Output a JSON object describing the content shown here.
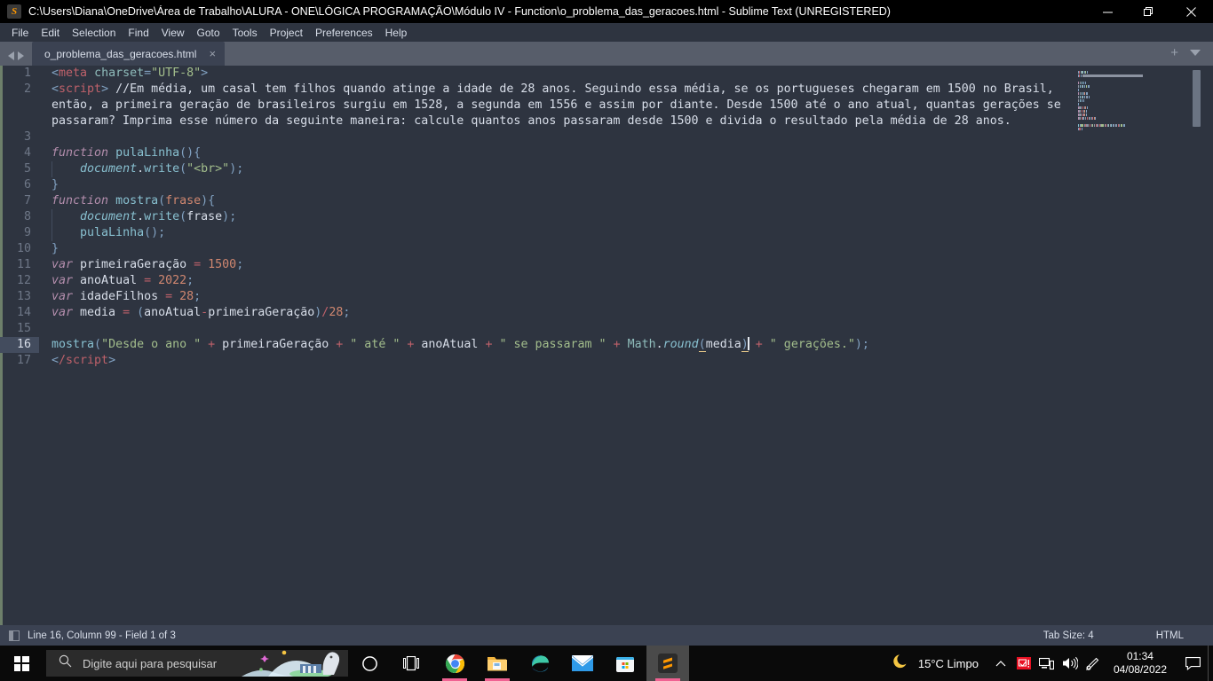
{
  "window": {
    "title": "C:\\Users\\Diana\\OneDrive\\Área de Trabalho\\ALURA - ONE\\LÓGICA PROGRAMAÇÃO\\Módulo IV - Function\\o_problema_das_geracoes.html - Sublime Text (UNREGISTERED)",
    "app_icon": "S",
    "minimize_label": "Minimize",
    "maximize_label": "Restore",
    "close_label": "Close"
  },
  "menubar": {
    "items": [
      "File",
      "Edit",
      "Selection",
      "Find",
      "View",
      "Goto",
      "Tools",
      "Project",
      "Preferences",
      "Help"
    ]
  },
  "tabbar": {
    "tabs": [
      {
        "label": "o_problema_das_geracoes.html",
        "close": "×",
        "active": true
      }
    ],
    "new_tab": "+",
    "dropdown": "chevron-down-icon"
  },
  "editor": {
    "background": "#2e3440",
    "active_line": 16,
    "lines": [
      {
        "n": 1,
        "tokens": [
          {
            "t": "<",
            "c": "punc"
          },
          {
            "t": "meta",
            "c": "tag"
          },
          {
            "t": " ",
            "c": "plain"
          },
          {
            "t": "charset",
            "c": "attr"
          },
          {
            "t": "=",
            "c": "punc"
          },
          {
            "t": "\"UTF-8\"",
            "c": "str"
          },
          {
            "t": ">",
            "c": "punc"
          }
        ]
      },
      {
        "n": 2,
        "tokens": [
          {
            "t": "<",
            "c": "punc"
          },
          {
            "t": "script",
            "c": "tag"
          },
          {
            "t": ">",
            "c": "punc"
          },
          {
            "t": " //Em média, um casal tem filhos quando atinge a idade de 28 anos. Seguindo essa média, se os portugueses chegaram em 1500 no Brasil, então, a primeira geração de brasileiros surgiu em 1528, a segunda em 1556 e assim por diante. Desde 1500 até o ano atual, quantas gerações se passaram? Imprima esse número da seguinte maneira: calcule quantos anos passaram desde 1500 e divida o resultado pela média de 28 anos.",
            "c": "comment"
          }
        ]
      },
      {
        "n": 3,
        "tokens": []
      },
      {
        "n": 4,
        "tokens": [
          {
            "t": "function",
            "c": "kw"
          },
          {
            "t": " ",
            "c": "plain"
          },
          {
            "t": "pulaLinha",
            "c": "fn"
          },
          {
            "t": "()",
            "c": "punc"
          },
          {
            "t": "{",
            "c": "punc"
          }
        ]
      },
      {
        "n": 5,
        "indent": 1,
        "tokens": [
          {
            "t": "    ",
            "c": "plain"
          },
          {
            "t": "document",
            "c": "fn-i"
          },
          {
            "t": ".",
            "c": "plain"
          },
          {
            "t": "write",
            "c": "fn"
          },
          {
            "t": "(",
            "c": "punc"
          },
          {
            "t": "\"<br>\"",
            "c": "str"
          },
          {
            "t": ")",
            "c": "punc"
          },
          {
            "t": ";",
            "c": "punc"
          }
        ]
      },
      {
        "n": 6,
        "tokens": [
          {
            "t": "}",
            "c": "punc"
          }
        ]
      },
      {
        "n": 7,
        "tokens": [
          {
            "t": "function",
            "c": "kw"
          },
          {
            "t": " ",
            "c": "plain"
          },
          {
            "t": "mostra",
            "c": "fn"
          },
          {
            "t": "(",
            "c": "punc"
          },
          {
            "t": "frase",
            "c": "param"
          },
          {
            "t": ")",
            "c": "punc"
          },
          {
            "t": "{",
            "c": "punc"
          }
        ]
      },
      {
        "n": 8,
        "indent": 1,
        "tokens": [
          {
            "t": "    ",
            "c": "plain"
          },
          {
            "t": "document",
            "c": "fn-i"
          },
          {
            "t": ".",
            "c": "plain"
          },
          {
            "t": "write",
            "c": "fn"
          },
          {
            "t": "(",
            "c": "punc"
          },
          {
            "t": "frase",
            "c": "plain"
          },
          {
            "t": ")",
            "c": "punc"
          },
          {
            "t": ";",
            "c": "punc"
          }
        ]
      },
      {
        "n": 9,
        "indent": 1,
        "tokens": [
          {
            "t": "    ",
            "c": "plain"
          },
          {
            "t": "pulaLinha",
            "c": "fn"
          },
          {
            "t": "()",
            "c": "punc"
          },
          {
            "t": ";",
            "c": "punc"
          }
        ]
      },
      {
        "n": 10,
        "tokens": [
          {
            "t": "}",
            "c": "punc"
          }
        ]
      },
      {
        "n": 11,
        "tokens": [
          {
            "t": "var",
            "c": "kw"
          },
          {
            "t": " primeiraGeração ",
            "c": "plain"
          },
          {
            "t": "=",
            "c": "op"
          },
          {
            "t": " ",
            "c": "plain"
          },
          {
            "t": "1500",
            "c": "num"
          },
          {
            "t": ";",
            "c": "punc"
          }
        ]
      },
      {
        "n": 12,
        "tokens": [
          {
            "t": "var",
            "c": "kw"
          },
          {
            "t": " anoAtual ",
            "c": "plain"
          },
          {
            "t": "=",
            "c": "op"
          },
          {
            "t": " ",
            "c": "plain"
          },
          {
            "t": "2022",
            "c": "num"
          },
          {
            "t": ";",
            "c": "punc"
          }
        ]
      },
      {
        "n": 13,
        "tokens": [
          {
            "t": "var",
            "c": "kw"
          },
          {
            "t": " idadeFilhos ",
            "c": "plain"
          },
          {
            "t": "=",
            "c": "op"
          },
          {
            "t": " ",
            "c": "plain"
          },
          {
            "t": "28",
            "c": "num"
          },
          {
            "t": ";",
            "c": "punc"
          }
        ]
      },
      {
        "n": 14,
        "tokens": [
          {
            "t": "var",
            "c": "kw"
          },
          {
            "t": " media ",
            "c": "plain"
          },
          {
            "t": "=",
            "c": "op"
          },
          {
            "t": " ",
            "c": "plain"
          },
          {
            "t": "(",
            "c": "punc"
          },
          {
            "t": "anoAtual",
            "c": "plain"
          },
          {
            "t": "-",
            "c": "op"
          },
          {
            "t": "primeiraGeração",
            "c": "plain"
          },
          {
            "t": ")",
            "c": "punc"
          },
          {
            "t": "/",
            "c": "op"
          },
          {
            "t": "28",
            "c": "num"
          },
          {
            "t": ";",
            "c": "punc"
          }
        ]
      },
      {
        "n": 15,
        "tokens": []
      },
      {
        "n": 16,
        "active": true,
        "tokens": [
          {
            "t": "mostra",
            "c": "fn"
          },
          {
            "t": "(",
            "c": "punc"
          },
          {
            "t": "\"Desde o ano \"",
            "c": "str"
          },
          {
            "t": " ",
            "c": "plain"
          },
          {
            "t": "+",
            "c": "op"
          },
          {
            "t": " primeiraGeração ",
            "c": "plain"
          },
          {
            "t": "+",
            "c": "op"
          },
          {
            "t": " ",
            "c": "plain"
          },
          {
            "t": "\" até \"",
            "c": "str"
          },
          {
            "t": " ",
            "c": "plain"
          },
          {
            "t": "+",
            "c": "op"
          },
          {
            "t": " anoAtual ",
            "c": "plain"
          },
          {
            "t": "+",
            "c": "op"
          },
          {
            "t": " ",
            "c": "plain"
          },
          {
            "t": "\" se passaram \"",
            "c": "str"
          },
          {
            "t": " ",
            "c": "plain"
          },
          {
            "t": "+",
            "c": "op"
          },
          {
            "t": " ",
            "c": "plain"
          },
          {
            "t": "Math",
            "c": "obj"
          },
          {
            "t": ".",
            "c": "plain"
          },
          {
            "t": "round",
            "c": "fn-i"
          },
          {
            "t": "(",
            "c": "punc",
            "hl": true
          },
          {
            "t": "media",
            "c": "plain"
          },
          {
            "t": ")",
            "c": "punc",
            "hl": true
          },
          {
            "t": "CURSOR",
            "c": "cursor"
          },
          {
            "t": " ",
            "c": "plain"
          },
          {
            "t": "+",
            "c": "op"
          },
          {
            "t": " ",
            "c": "plain"
          },
          {
            "t": "\" gerações.\"",
            "c": "str"
          },
          {
            "t": ")",
            "c": "punc"
          },
          {
            "t": ";",
            "c": "punc"
          }
        ]
      },
      {
        "n": 17,
        "tokens": [
          {
            "t": "<",
            "c": "punc"
          },
          {
            "t": "/script",
            "c": "tag"
          },
          {
            "t": ">",
            "c": "punc"
          }
        ]
      }
    ]
  },
  "statusbar": {
    "position": "Line 16, Column 99 - Field 1 of 3",
    "tab_size": "Tab Size: 4",
    "syntax": "HTML"
  },
  "taskbar": {
    "start": "windows-logo",
    "search_placeholder": "Digite aqui para pesquisar",
    "icons": [
      {
        "name": "cortana-icon",
        "running": false,
        "active": false
      },
      {
        "name": "task-view-icon",
        "running": false,
        "active": false
      },
      {
        "name": "google-chrome-icon",
        "running": true,
        "active": false
      },
      {
        "name": "file-explorer-icon",
        "running": true,
        "active": false
      },
      {
        "name": "microsoft-edge-icon",
        "running": false,
        "active": false
      },
      {
        "name": "mail-icon",
        "running": false,
        "active": false
      },
      {
        "name": "microsoft-store-icon",
        "running": false,
        "active": false
      },
      {
        "name": "sublime-text-icon",
        "running": true,
        "active": true
      }
    ],
    "weather": {
      "icon": "moon-icon",
      "text": "15°C  Limpo"
    },
    "tray": [
      "chevron-up-icon",
      "warning-icon",
      "network-icon",
      "volume-icon",
      "pen-icon"
    ],
    "clock": {
      "time": "01:34",
      "date": "04/08/2022"
    },
    "notifications": "notification-icon"
  }
}
